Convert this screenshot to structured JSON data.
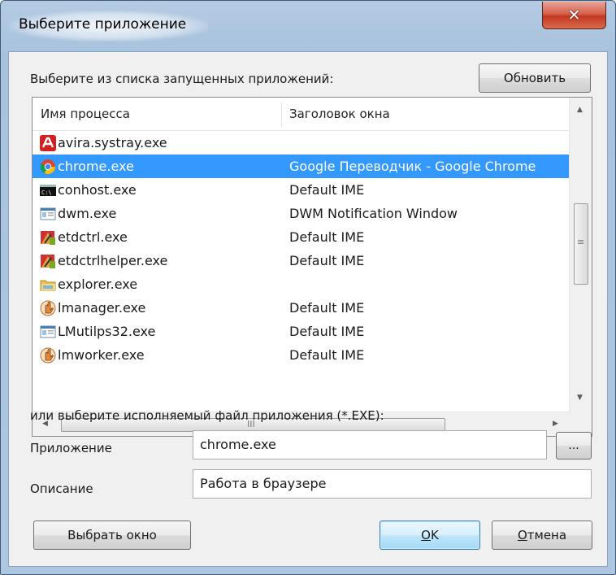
{
  "window": {
    "title": "Выберите приложение",
    "close_label": "✕"
  },
  "running_section": {
    "label": "Выберите из списка запущенных приложений:",
    "refresh_label": "Обновить"
  },
  "list": {
    "columns": [
      "Имя процесса",
      "Заголовок окна"
    ],
    "rows": [
      {
        "name": "avira.systray.exe",
        "title": "",
        "icon": "avira-icon",
        "selected": false
      },
      {
        "name": "chrome.exe",
        "title": "Google Переводчик - Google Chrome",
        "icon": "chrome-icon",
        "selected": true
      },
      {
        "name": "conhost.exe",
        "title": "Default IME",
        "icon": "console-icon",
        "selected": false
      },
      {
        "name": "dwm.exe",
        "title": "DWM Notification Window",
        "icon": "window-app-icon",
        "selected": false
      },
      {
        "name": "etdctrl.exe",
        "title": "Default IME",
        "icon": "setup-app-icon",
        "selected": false
      },
      {
        "name": "etdctrlhelper.exe",
        "title": "Default IME",
        "icon": "setup-app-icon",
        "selected": false
      },
      {
        "name": "explorer.exe",
        "title": "",
        "icon": "folder-icon",
        "selected": false
      },
      {
        "name": "lmanager.exe",
        "title": "Default IME",
        "icon": "hand-app-icon",
        "selected": false
      },
      {
        "name": "LMutilps32.exe",
        "title": "Default IME",
        "icon": "window-app-icon",
        "selected": false
      },
      {
        "name": "lmworker.exe",
        "title": "Default IME",
        "icon": "hand-app-icon",
        "selected": false
      }
    ],
    "hscroll_grip": "III"
  },
  "exe_section": {
    "label": "или выберите исполняемый файл приложения (*.EXE):",
    "app_label": "Приложение",
    "app_value": "chrome.exe",
    "browse_label": "...",
    "desc_label": "Описание",
    "desc_value": "Работа в браузере"
  },
  "buttons": {
    "pick_window": "Выбрать окно",
    "ok_hotkey": "O",
    "ok_rest": "K",
    "cancel_hotkey": "О",
    "cancel_rest": "тмена"
  },
  "colors": {
    "selection": "#3399ff",
    "close_button": "#c7402a",
    "frame": "#aec6df"
  }
}
